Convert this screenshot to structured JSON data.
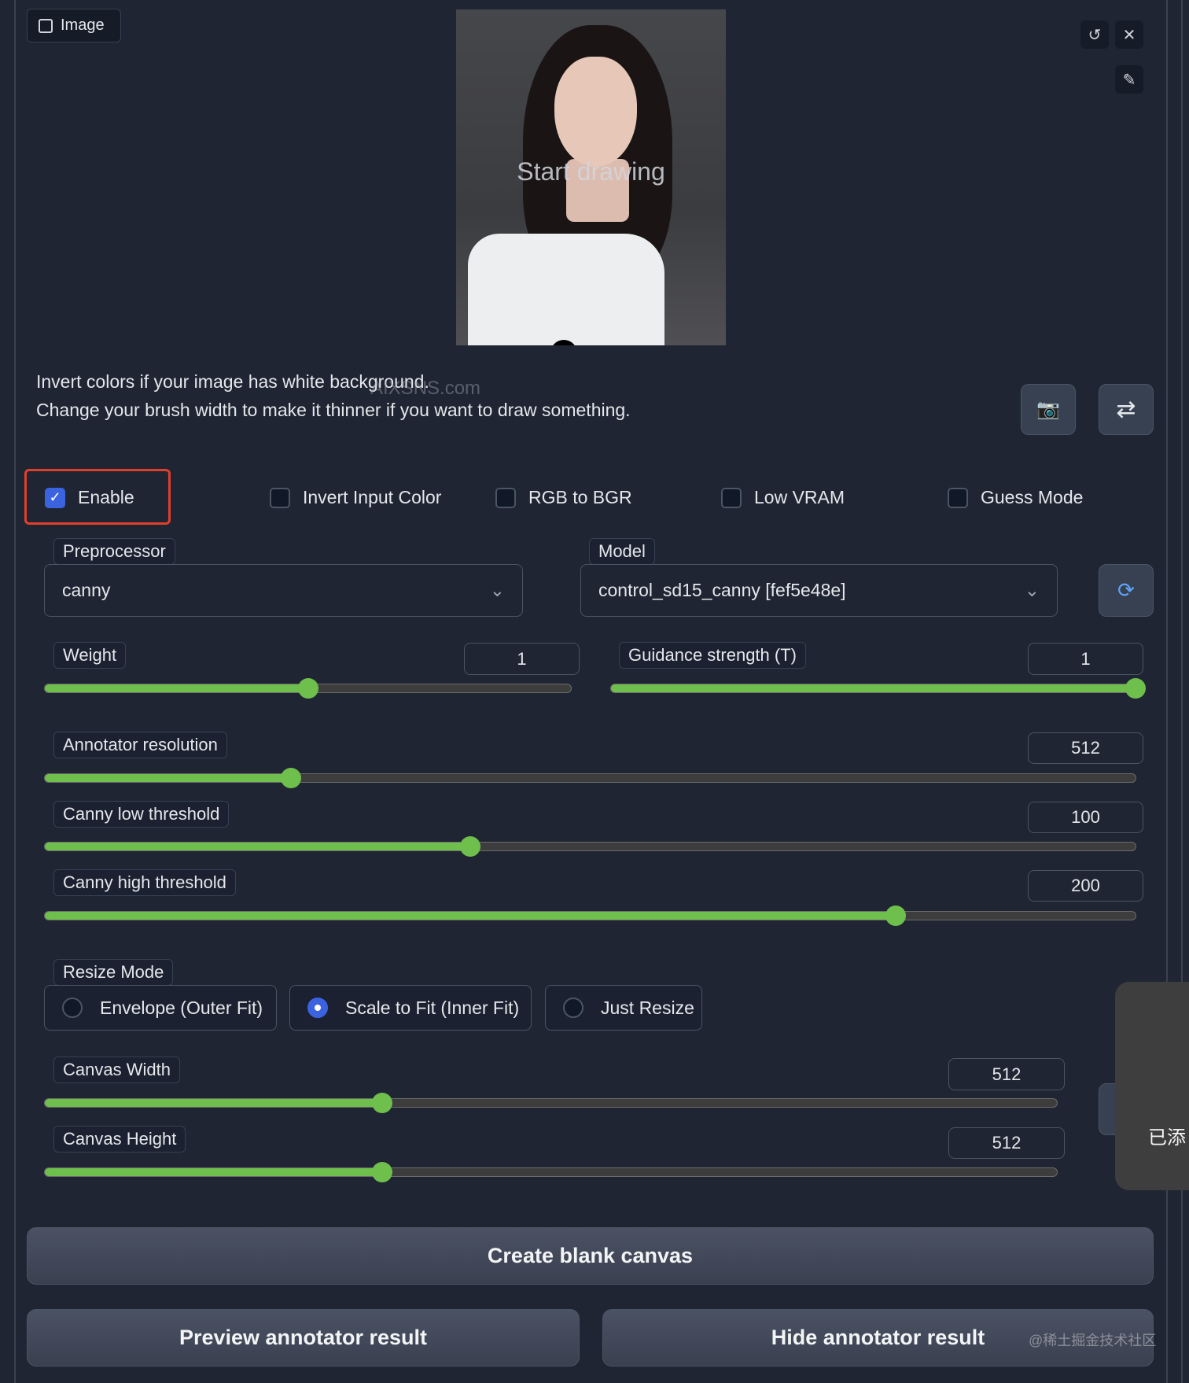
{
  "image_tab": {
    "label": "Image",
    "icon": "image-icon"
  },
  "canvas": {
    "overlay_text": "Start drawing",
    "watermark": "AIXSNS.com"
  },
  "canvas_tools": {
    "undo_icon": "undo-icon",
    "close_icon": "close-icon",
    "brush_icon": "brush-icon"
  },
  "info": {
    "line1": "Invert colors if your image has white background.",
    "line2": "Change your brush width to make it thinner if you want to draw something."
  },
  "side_buttons": {
    "camera_icon": "📷",
    "swap_icon": "⇄"
  },
  "checkboxes": [
    {
      "label": "Enable",
      "checked": true
    },
    {
      "label": "Invert Input Color",
      "checked": false
    },
    {
      "label": "RGB to BGR",
      "checked": false
    },
    {
      "label": "Low VRAM",
      "checked": false
    },
    {
      "label": "Guess Mode",
      "checked": false
    }
  ],
  "highlight_color": "#e0402b",
  "accent_color": "#6fbf4c",
  "preprocessor": {
    "label": "Preprocessor",
    "value": "canny"
  },
  "model": {
    "label": "Model",
    "value": "control_sd15_canny [fef5e48e]",
    "refresh_icon": "refresh-icon"
  },
  "sliders": {
    "weight": {
      "label": "Weight",
      "value": "1",
      "fraction": 0.5
    },
    "guidance": {
      "label": "Guidance strength (T)",
      "value": "1",
      "fraction": 1.0
    },
    "annotator_resolution": {
      "label": "Annotator resolution",
      "value": "512",
      "fraction": 0.226
    },
    "canny_low": {
      "label": "Canny low threshold",
      "value": "100",
      "fraction": 0.39
    },
    "canny_high": {
      "label": "Canny high threshold",
      "value": "200",
      "fraction": 0.78
    },
    "canvas_width": {
      "label": "Canvas Width",
      "value": "512",
      "fraction": 0.333
    },
    "canvas_height": {
      "label": "Canvas Height",
      "value": "512",
      "fraction": 0.333
    }
  },
  "resize_mode": {
    "label": "Resize Mode",
    "options": [
      {
        "label": "Envelope (Outer Fit)",
        "selected": false
      },
      {
        "label": "Scale to Fit (Inner Fit)",
        "selected": true
      },
      {
        "label": "Just Resize",
        "selected": false
      }
    ]
  },
  "buttons": {
    "create_canvas": "Create blank canvas",
    "preview": "Preview annotator result",
    "hide": "Hide annotator result"
  },
  "toast": {
    "text": "已添"
  },
  "footer_watermark": "@稀土掘金技术社区"
}
